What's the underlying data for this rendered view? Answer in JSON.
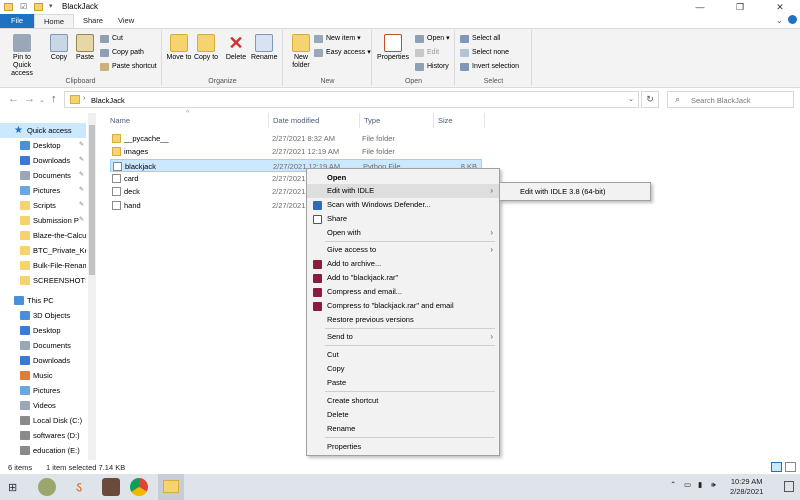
{
  "window": {
    "title": "BlackJack",
    "min": "—",
    "max": "❐",
    "close": "✕"
  },
  "ribbon_tabs": [
    "File",
    "Home",
    "Share",
    "View"
  ],
  "ribbon": {
    "clipboard": {
      "label": "Clipboard",
      "pin": "Pin to Quick access",
      "copy": "Copy",
      "paste": "Paste",
      "cut": "Cut",
      "copy_path": "Copy path",
      "paste_shortcut": "Paste shortcut"
    },
    "organize": {
      "label": "Organize",
      "move_to": "Move to",
      "copy_to": "Copy to",
      "delete": "Delete",
      "rename": "Rename"
    },
    "new": {
      "label": "New",
      "new_folder": "New folder",
      "new_item": "New item",
      "easy_access": "Easy access"
    },
    "open": {
      "label": "Open",
      "properties": "Properties",
      "open": "Open",
      "edit": "Edit",
      "history": "History"
    },
    "select": {
      "label": "Select",
      "select_all": "Select all",
      "select_none": "Select none",
      "invert": "Invert selection"
    }
  },
  "address": {
    "path": "BlackJack",
    "search_placeholder": "Search BlackJack"
  },
  "nav": {
    "quick_access": "Quick access",
    "quick_items": [
      "Desktop",
      "Downloads",
      "Documents",
      "Pictures",
      "Scripts",
      "Submission P",
      "Blaze-the-Calcul",
      "BTC_Private_Key_",
      "Bulk-File-Renam",
      "SCREENSHOTS"
    ],
    "this_pc": "This PC",
    "pc_items": [
      "3D Objects",
      "Desktop",
      "Documents",
      "Downloads",
      "Music",
      "Pictures",
      "Videos",
      "Local Disk (C:)",
      "softwares (D:)",
      "education (E:)"
    ]
  },
  "columns": {
    "name": "Name",
    "date": "Date modified",
    "type": "Type",
    "size": "Size"
  },
  "files": [
    {
      "name": "__pycache__",
      "date": "2/27/2021 8:32 AM",
      "type": "File folder",
      "size": ""
    },
    {
      "name": "images",
      "date": "2/27/2021 12:19 AM",
      "type": "File folder",
      "size": ""
    },
    {
      "name": "blackjack",
      "date": "2/27/2021 12:19 AM",
      "type": "Python File",
      "size": "8 KB"
    },
    {
      "name": "card",
      "date": "2/27/2021",
      "type": "",
      "size": ""
    },
    {
      "name": "deck",
      "date": "2/27/2021",
      "type": "",
      "size": ""
    },
    {
      "name": "hand",
      "date": "2/27/2021",
      "type": "",
      "size": ""
    }
  ],
  "context_menu": [
    "Open",
    "Edit with IDLE",
    "Scan with Windows Defender...",
    "Share",
    "Open with",
    "Give access to",
    "Add to archive...",
    "Add to \"blackjack.rar\"",
    "Compress and email...",
    "Compress to \"blackjack.rar\" and email",
    "Restore previous versions",
    "Send to",
    "Cut",
    "Copy",
    "Paste",
    "Create shortcut",
    "Delete",
    "Rename",
    "Properties"
  ],
  "submenu": {
    "item": "Edit with IDLE 3.8 (64-bit)"
  },
  "status": {
    "items": "6 items",
    "selected": "1 item selected  7.14 KB"
  },
  "taskbar": {
    "time": "10:29 AM",
    "date": "2/28/2021"
  },
  "colors": {
    "accent": "#1e72c0",
    "selection": "#cce8ff",
    "folder": "#f5d36e"
  }
}
